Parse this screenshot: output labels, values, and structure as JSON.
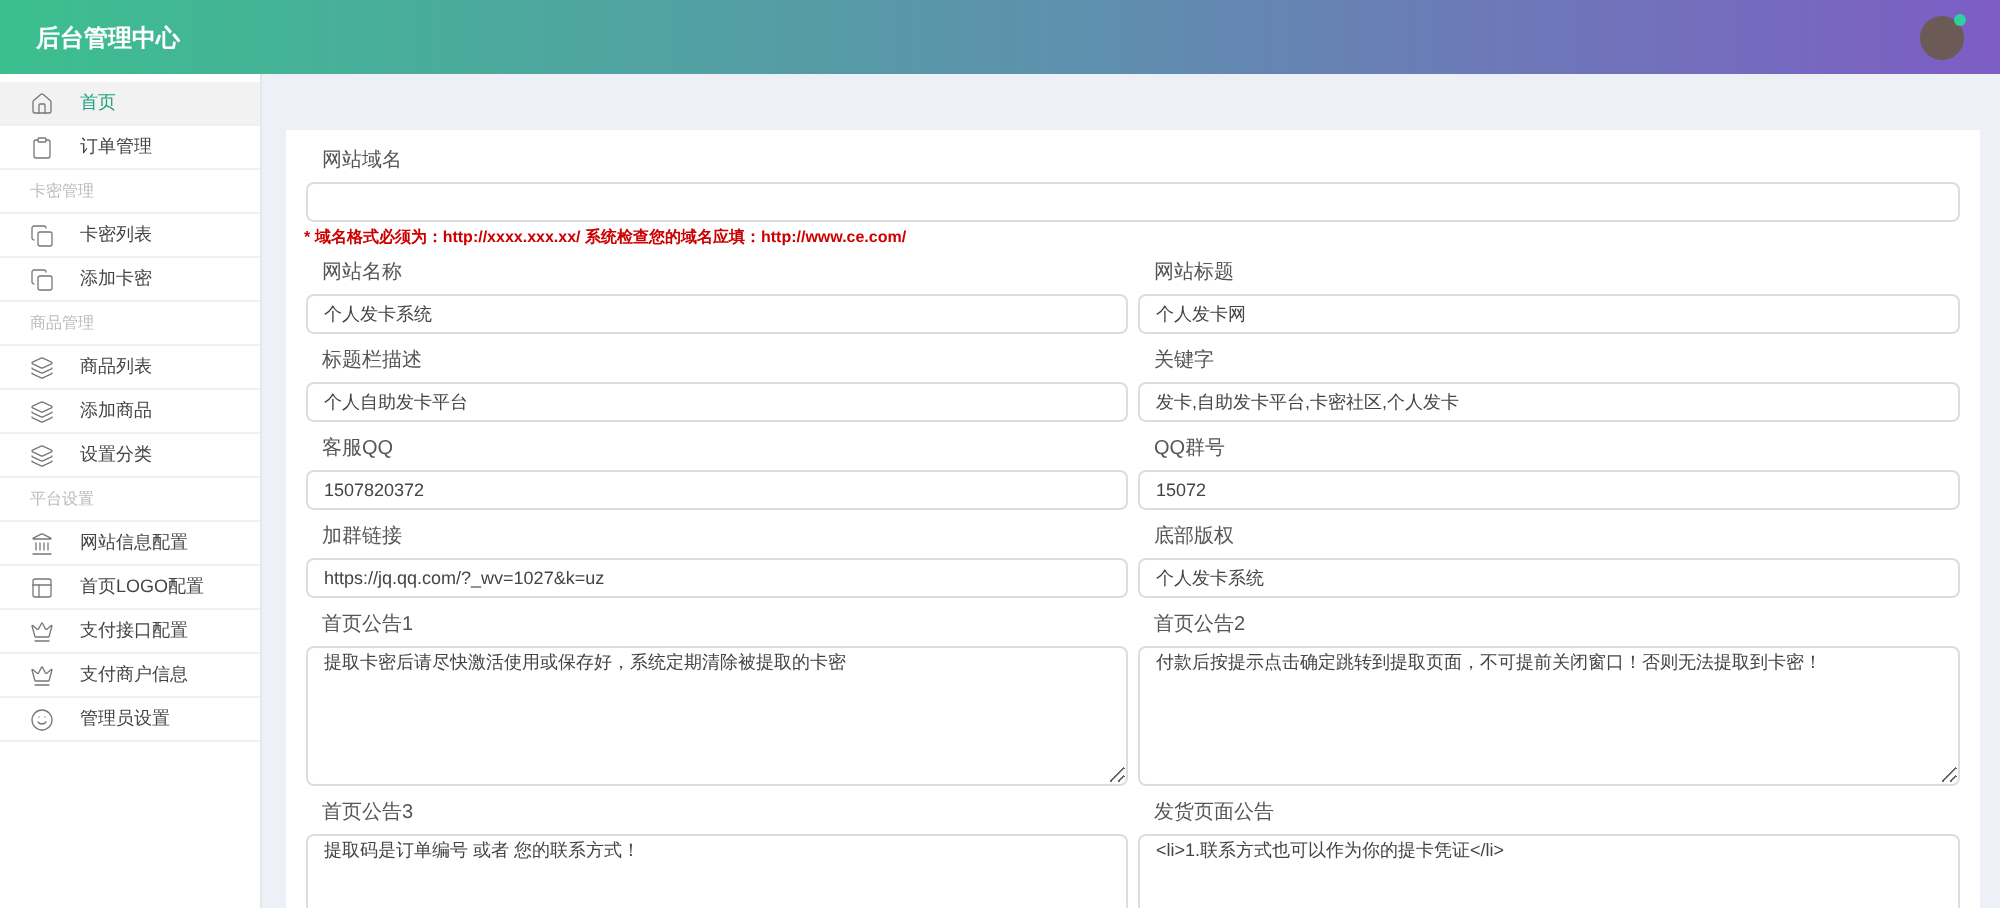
{
  "header": {
    "title": "后台管理中心"
  },
  "sidebar": {
    "items": [
      {
        "kind": "item",
        "label": "首页",
        "selected": true
      },
      {
        "kind": "item",
        "label": "订单管理",
        "selected": false
      },
      {
        "kind": "group",
        "label": "卡密管理"
      },
      {
        "kind": "item",
        "label": "卡密列表",
        "selected": false
      },
      {
        "kind": "item",
        "label": "添加卡密",
        "selected": false
      },
      {
        "kind": "group",
        "label": "商品管理"
      },
      {
        "kind": "item",
        "label": "商品列表",
        "selected": false
      },
      {
        "kind": "item",
        "label": "添加商品",
        "selected": false
      },
      {
        "kind": "item",
        "label": "设置分类",
        "selected": false
      },
      {
        "kind": "group",
        "label": "平台设置"
      },
      {
        "kind": "item",
        "label": "网站信息配置",
        "selected": false
      },
      {
        "kind": "item",
        "label": "首页LOGO配置",
        "selected": false
      },
      {
        "kind": "item",
        "label": "支付接口配置",
        "selected": false
      },
      {
        "kind": "item",
        "label": "支付商户信息",
        "selected": false
      },
      {
        "kind": "item",
        "label": "管理员设置",
        "selected": false
      }
    ]
  },
  "form": {
    "domain": {
      "label": "网站域名",
      "note": "* 域名格式必须为：http://xxxx.xxx.xx/ 系统检查您的域名应填：http://www.ce.com/"
    },
    "fields": [
      {
        "kind": "input",
        "label": "网站名称",
        "value": "个人发卡系统"
      },
      {
        "kind": "input",
        "label": "网站标题",
        "value": "个人发卡网"
      },
      {
        "kind": "input",
        "label": "标题栏描述",
        "value": "个人自助发卡平台"
      },
      {
        "kind": "input",
        "label": "关键字",
        "value": "发卡,自助发卡平台,卡密社区,个人发卡"
      },
      {
        "kind": "input",
        "label": "客服QQ",
        "value": "1507820372"
      },
      {
        "kind": "input",
        "label": "QQ群号",
        "value": "15072"
      },
      {
        "kind": "input",
        "label": "加群链接",
        "value": "https://jq.qq.com/?_wv=1027&k=uz"
      },
      {
        "kind": "input",
        "label": "底部版权",
        "value": "个人发卡系统"
      },
      {
        "kind": "textarea",
        "label": "首页公告1",
        "value": "提取卡密后请尽快激活使用或保存好，系统定期清除被提取的卡密"
      },
      {
        "kind": "textarea",
        "label": "首页公告2",
        "value": "付款后按提示点击确定跳转到提取页面，不可提前关闭窗口！否则无法提取到卡密！"
      },
      {
        "kind": "textarea",
        "label": "首页公告3",
        "value": "提取码是订单编号 或者 您的联系方式！"
      },
      {
        "kind": "textarea",
        "label": "发货页面公告",
        "value": "<li>1.联系方式也可以作为你的提卡凭证</li>"
      }
    ]
  }
}
